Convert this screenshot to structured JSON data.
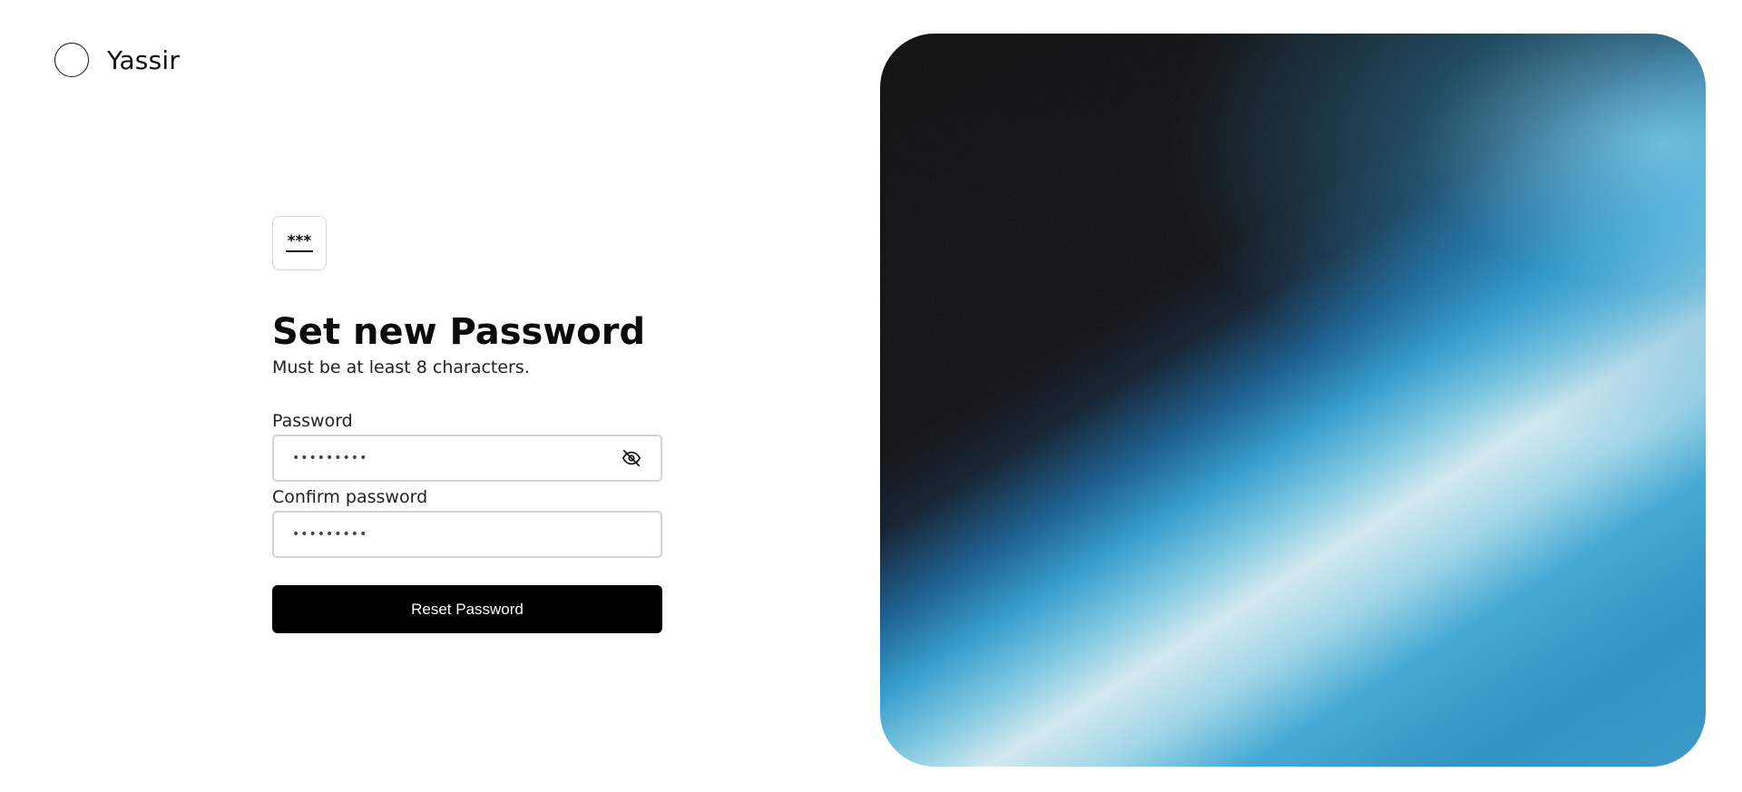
{
  "brand": {
    "name": "Yassir"
  },
  "form": {
    "icon": "password-asterisks-icon",
    "icon_glyph": "***",
    "title": "Set new Password",
    "subtitle": "Must be at least 8 characters.",
    "password": {
      "label": "Password",
      "value": "•••••••••",
      "toggle_icon": "eye-off-icon"
    },
    "confirm_password": {
      "label": "Confirm password",
      "value": "•••••••••"
    },
    "submit_label": "Reset Password"
  },
  "hero": {
    "colors": {
      "dark": "#0b0b0c",
      "blue": "#2a8fc4",
      "light": "#d5ecf3"
    }
  }
}
